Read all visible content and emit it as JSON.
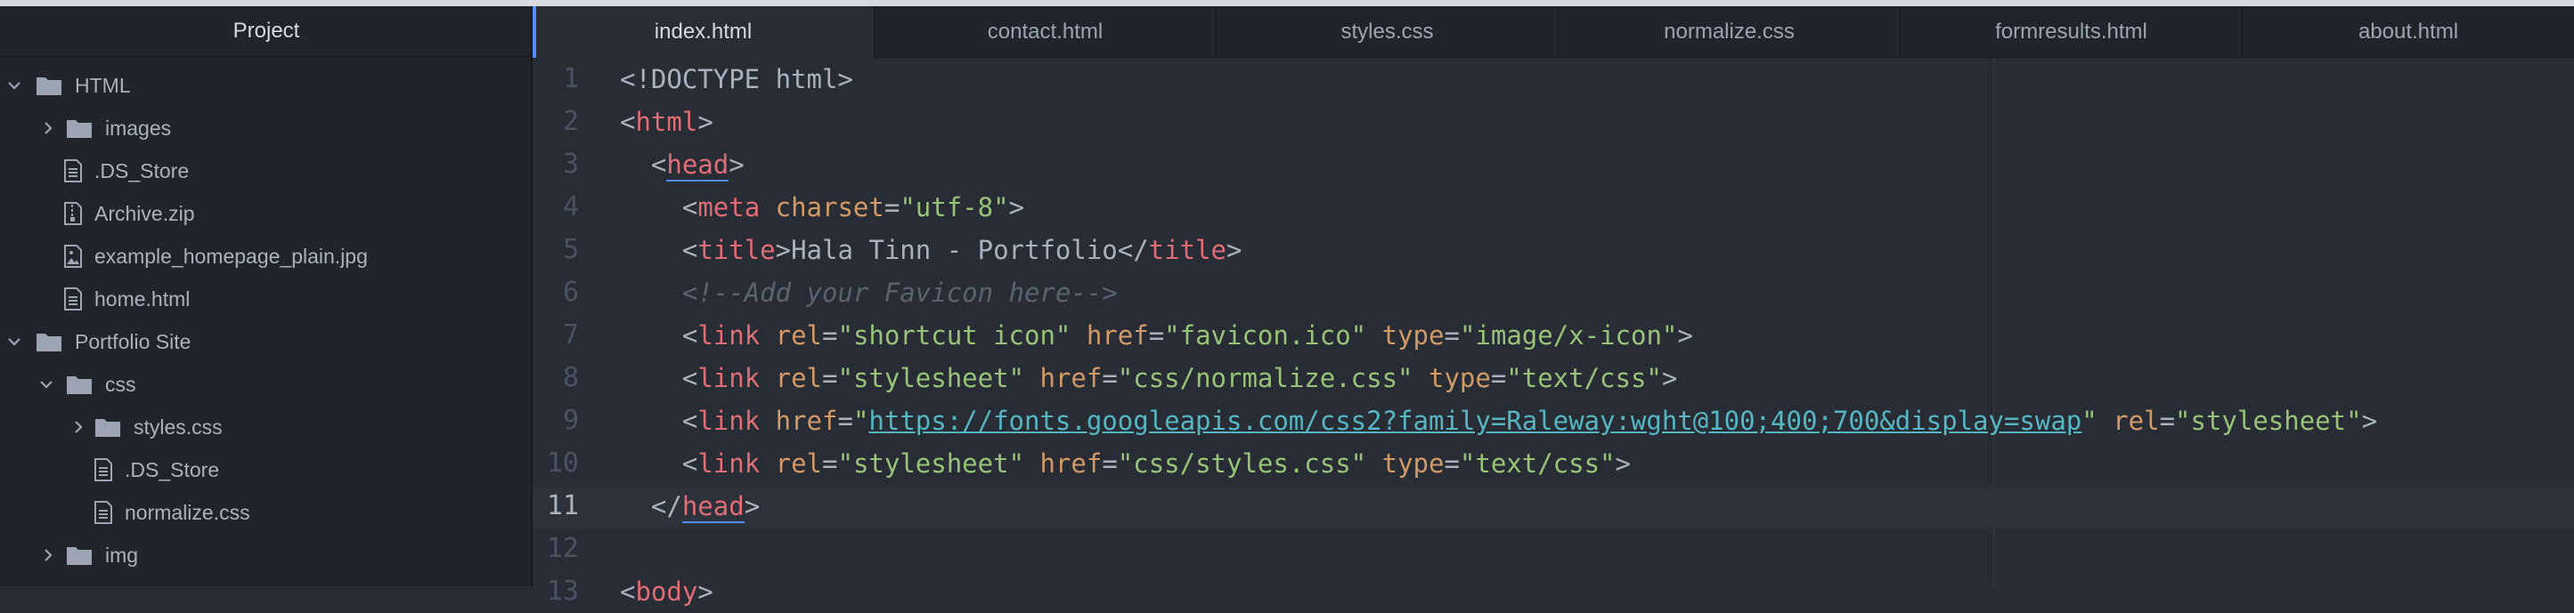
{
  "tree": {
    "title": "Project",
    "items": [
      {
        "label": "HTML",
        "kind": "folder",
        "expanded": true
      },
      {
        "label": "images",
        "kind": "folder",
        "expanded": false
      },
      {
        "label": ".DS_Store",
        "kind": "file"
      },
      {
        "label": "Archive.zip",
        "kind": "zip"
      },
      {
        "label": "example_homepage_plain.jpg",
        "kind": "image"
      },
      {
        "label": "home.html",
        "kind": "file"
      },
      {
        "label": "Portfolio Site",
        "kind": "folder",
        "expanded": true
      },
      {
        "label": "css",
        "kind": "folder",
        "expanded": true
      },
      {
        "label": "styles.css",
        "kind": "folder",
        "expanded": false
      },
      {
        "label": ".DS_Store",
        "kind": "file"
      },
      {
        "label": "normalize.css",
        "kind": "file"
      },
      {
        "label": "img",
        "kind": "folder",
        "expanded": false
      }
    ]
  },
  "tabs": [
    {
      "label": "index.html",
      "active": true
    },
    {
      "label": "contact.html",
      "active": false
    },
    {
      "label": "styles.css",
      "active": false
    },
    {
      "label": "normalize.css",
      "active": false
    },
    {
      "label": "formresults.html",
      "active": false
    },
    {
      "label": "about.html",
      "active": false
    }
  ],
  "editor": {
    "cursor_line": 11,
    "lines": [
      {
        "num": "1",
        "tokens": [
          [
            "punct",
            "<!DOCTYPE html>"
          ]
        ]
      },
      {
        "num": "2",
        "tokens": [
          [
            "punct",
            "<"
          ],
          [
            "tag",
            "html"
          ],
          [
            "punct",
            ">"
          ]
        ]
      },
      {
        "num": "3",
        "tokens": [
          [
            "punct",
            "  <"
          ],
          [
            "tagm",
            "head"
          ],
          [
            "punct",
            ">"
          ]
        ]
      },
      {
        "num": "4",
        "tokens": [
          [
            "punct",
            "    <"
          ],
          [
            "tag",
            "meta"
          ],
          [
            "text",
            " "
          ],
          [
            "attr",
            "charset"
          ],
          [
            "punct",
            "="
          ],
          [
            "str",
            "\"utf-8\""
          ],
          [
            "punct",
            ">"
          ]
        ]
      },
      {
        "num": "5",
        "tokens": [
          [
            "punct",
            "    <"
          ],
          [
            "tag",
            "title"
          ],
          [
            "punct",
            ">"
          ],
          [
            "text",
            "Hala Tinn - Portfolio"
          ],
          [
            "punct",
            "</"
          ],
          [
            "tag",
            "title"
          ],
          [
            "punct",
            ">"
          ]
        ]
      },
      {
        "num": "6",
        "tokens": [
          [
            "comment",
            "    <!--Add your Favicon here-->"
          ]
        ]
      },
      {
        "num": "7",
        "tokens": [
          [
            "punct",
            "    <"
          ],
          [
            "tag",
            "link"
          ],
          [
            "text",
            " "
          ],
          [
            "attr",
            "rel"
          ],
          [
            "punct",
            "="
          ],
          [
            "str",
            "\"shortcut icon\""
          ],
          [
            "text",
            " "
          ],
          [
            "attr",
            "href"
          ],
          [
            "punct",
            "="
          ],
          [
            "str",
            "\"favicon.ico\""
          ],
          [
            "text",
            " "
          ],
          [
            "attr",
            "type"
          ],
          [
            "punct",
            "="
          ],
          [
            "str",
            "\"image/x-icon\""
          ],
          [
            "punct",
            ">"
          ]
        ]
      },
      {
        "num": "8",
        "tokens": [
          [
            "punct",
            "    <"
          ],
          [
            "tag",
            "link"
          ],
          [
            "text",
            " "
          ],
          [
            "attr",
            "rel"
          ],
          [
            "punct",
            "="
          ],
          [
            "str",
            "\"stylesheet\""
          ],
          [
            "text",
            " "
          ],
          [
            "attr",
            "href"
          ],
          [
            "punct",
            "="
          ],
          [
            "str",
            "\"css/normalize.css\""
          ],
          [
            "text",
            " "
          ],
          [
            "attr",
            "type"
          ],
          [
            "punct",
            "="
          ],
          [
            "str",
            "\"text/css\""
          ],
          [
            "punct",
            ">"
          ]
        ]
      },
      {
        "num": "9",
        "tokens": [
          [
            "punct",
            "    <"
          ],
          [
            "tag",
            "link"
          ],
          [
            "text",
            " "
          ],
          [
            "attr",
            "href"
          ],
          [
            "punct",
            "="
          ],
          [
            "str",
            "\""
          ],
          [
            "url",
            "https://fonts.googleapis.com/css2?family=Raleway:wght@100;400;700&display=swap"
          ],
          [
            "str",
            "\""
          ],
          [
            "text",
            " "
          ],
          [
            "attr",
            "rel"
          ],
          [
            "punct",
            "="
          ],
          [
            "str",
            "\"stylesheet\""
          ],
          [
            "punct",
            ">"
          ]
        ]
      },
      {
        "num": "10",
        "tokens": [
          [
            "punct",
            "    <"
          ],
          [
            "tag",
            "link"
          ],
          [
            "text",
            " "
          ],
          [
            "attr",
            "rel"
          ],
          [
            "punct",
            "="
          ],
          [
            "str",
            "\"stylesheet\""
          ],
          [
            "text",
            " "
          ],
          [
            "attr",
            "href"
          ],
          [
            "punct",
            "="
          ],
          [
            "str",
            "\"css/styles.css\""
          ],
          [
            "text",
            " "
          ],
          [
            "attr",
            "type"
          ],
          [
            "punct",
            "="
          ],
          [
            "str",
            "\"text/css\""
          ],
          [
            "punct",
            ">"
          ]
        ]
      },
      {
        "num": "11",
        "tokens": [
          [
            "punct",
            "  </"
          ],
          [
            "tagm",
            "head"
          ],
          [
            "punct",
            ">"
          ]
        ]
      },
      {
        "num": "12",
        "tokens": []
      },
      {
        "num": "13",
        "tokens": [
          [
            "punct",
            "<"
          ],
          [
            "tag",
            "body"
          ],
          [
            "punct",
            ">"
          ]
        ]
      }
    ]
  },
  "colors": {
    "accent": "#568af2",
    "background": "#282c34",
    "tree_background": "#21252b"
  }
}
